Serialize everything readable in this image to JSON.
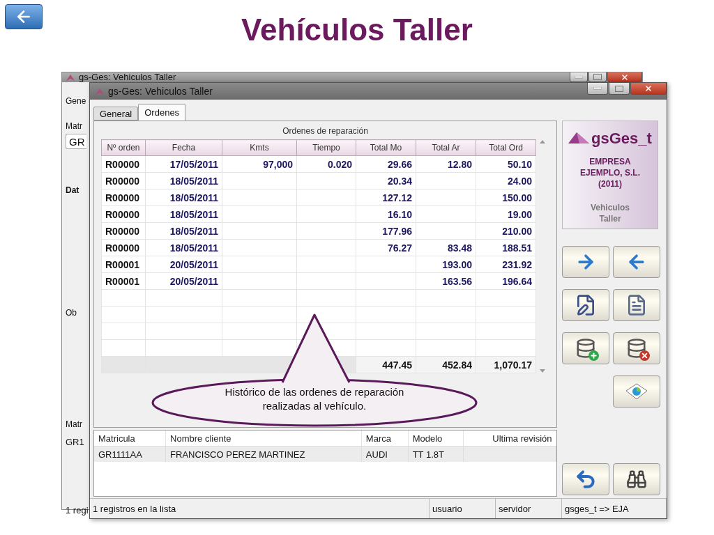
{
  "slide": {
    "title": "Vehículos Taller"
  },
  "back_window": {
    "title": "gs-Ges: Vehiculos Taller",
    "tab": "Gene",
    "field_label": "Matr",
    "field_value": "GR",
    "group_label": "Dat",
    "notes_label": "Ob",
    "list_header": "Matr",
    "list_cell": "GR1",
    "status": "1 regi"
  },
  "window": {
    "title": "gs-Ges: Vehiculos Taller",
    "tabs": [
      {
        "label": "General",
        "selected": false
      },
      {
        "label": "Ordenes",
        "selected": true
      }
    ],
    "orders": {
      "caption": "Ordenes de reparación",
      "columns": [
        "Nº orden",
        "Fecha",
        "Kmts",
        "Tiempo",
        "Total Mo",
        "Total Ar",
        "Total Ord"
      ],
      "rows": [
        {
          "order": "R00000",
          "date": "17/05/2011",
          "kmts": "97,000",
          "time": "0.020",
          "total_mo": "29.66",
          "total_ar": "12.80",
          "total_ord": "50.10"
        },
        {
          "order": "R00000",
          "date": "18/05/2011",
          "total_mo": "20.34",
          "total_ord": "24.00"
        },
        {
          "order": "R00000",
          "date": "18/05/2011",
          "total_mo": "127.12",
          "total_ord": "150.00"
        },
        {
          "order": "R00000",
          "date": "18/05/2011",
          "total_mo": "16.10",
          "total_ord": "19.00"
        },
        {
          "order": "R00000",
          "date": "18/05/2011",
          "total_mo": "177.96",
          "total_ord": "210.00"
        },
        {
          "order": "R00000",
          "date": "18/05/2011",
          "total_mo": "76.27",
          "total_ar": "83.48",
          "total_ord": "188.51"
        },
        {
          "order": "R00001",
          "date": "20/05/2011",
          "total_ar": "193.00",
          "total_ord": "231.92"
        },
        {
          "order": "R00001",
          "date": "20/05/2011",
          "total_ar": "163.56",
          "total_ord": "196.64"
        }
      ],
      "totals": {
        "total_mo": "447.45",
        "total_ar": "452.84",
        "total_ord": "1,070.17"
      }
    },
    "sidebar": {
      "logo": "gsGes_t",
      "company": "EMPRESA EJEMPLO, S.L. (2011)",
      "module": "Vehiculos Taller",
      "buttons": [
        {
          "kind": "next"
        },
        {
          "kind": "previous"
        },
        {
          "kind": "edit"
        },
        {
          "kind": "restore"
        },
        {
          "kind": "add"
        },
        {
          "kind": "delete"
        },
        {
          "kind": "report"
        }
      ],
      "bottom_buttons": [
        {
          "kind": "return"
        },
        {
          "kind": "search"
        }
      ]
    },
    "list": {
      "columns": [
        "Matricula",
        "Nombre cliente",
        "Marca",
        "Modelo",
        "Ultima revisión"
      ],
      "rows": [
        [
          "GR1111AA",
          "FRANCISCO PEREZ MARTINEZ",
          "AUDI",
          "TT 1.8T"
        ]
      ]
    },
    "status_bar": [
      "1 registros en la lista",
      "usuario",
      "servidor",
      "gsges_t => EJA"
    ]
  },
  "callout": {
    "text": "Histórico de las ordenes de reparación realizadas al vehículo."
  }
}
